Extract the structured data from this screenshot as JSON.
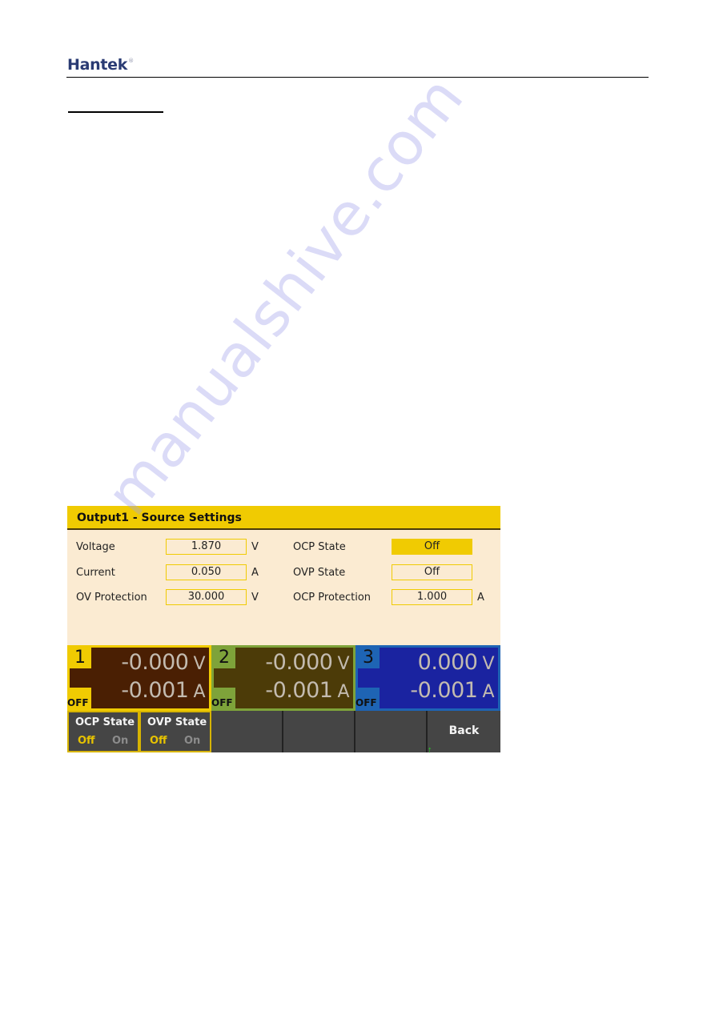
{
  "page": {
    "logo": "Hantek",
    "logo_mark": "®",
    "watermark": "manualshive.com"
  },
  "screen": {
    "title": "Output1 - Source Settings",
    "left_settings": [
      {
        "label": "Voltage",
        "value": "1.870",
        "unit": "V"
      },
      {
        "label": "Current",
        "value": "0.050",
        "unit": "A"
      },
      {
        "label": "OV Protection",
        "value": "30.000",
        "unit": "V"
      }
    ],
    "right_settings": [
      {
        "label": "OCP State",
        "value": "Off",
        "unit": "",
        "selected": true
      },
      {
        "label": "OVP State",
        "value": "Off",
        "unit": "",
        "selected": false
      },
      {
        "label": "OCP Protection",
        "value": "1.000",
        "unit": "A",
        "selected": false
      }
    ],
    "channels": [
      {
        "number": "1",
        "state": "OFF",
        "voltage": "-0.000",
        "voltage_unit": "V",
        "current": "-0.001",
        "current_unit": "A",
        "accent": "#f0cb02",
        "body": "#4a1f03"
      },
      {
        "number": "2",
        "state": "OFF",
        "voltage": "-0.000",
        "voltage_unit": "V",
        "current": "-0.001",
        "current_unit": "A",
        "accent": "#7ea33a",
        "body": "#4c3b08"
      },
      {
        "number": "3",
        "state": "OFF",
        "voltage": "0.000",
        "voltage_unit": "V",
        "current": "-0.001",
        "current_unit": "A",
        "accent": "#1e64b4",
        "body": "#1a23a0"
      }
    ],
    "softkeys": [
      {
        "title": "OCP State",
        "option_selected": "Off",
        "option_other": "On"
      },
      {
        "title": "OVP State",
        "option_selected": "Off",
        "option_other": "On"
      },
      {
        "title": ""
      },
      {
        "title": ""
      },
      {
        "title": ""
      },
      {
        "title": "Back",
        "indicator": "↑"
      }
    ]
  },
  "colors": {
    "title_bar": "#f0cb02",
    "panel_bg": "#fbebd2",
    "softkey_bg": "#454545",
    "selected_option": "#e7c300"
  }
}
